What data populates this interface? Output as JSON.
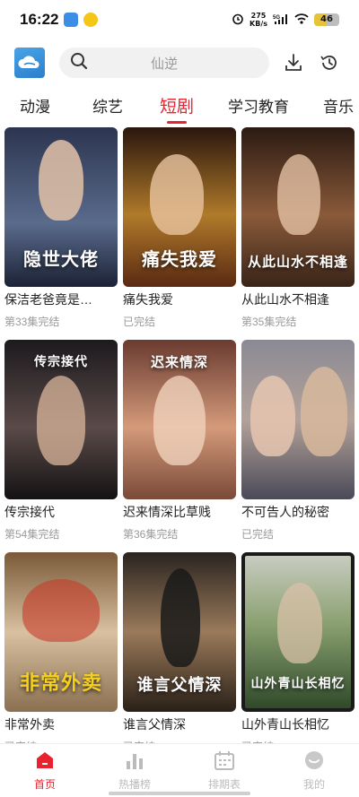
{
  "status": {
    "time": "16:22",
    "speed_top": "275",
    "speed_bottom": "KB/s",
    "network": "5G",
    "battery": "46"
  },
  "search": {
    "placeholder": "仙逆"
  },
  "tabs": [
    {
      "label": "动漫"
    },
    {
      "label": "综艺"
    },
    {
      "label": "短剧"
    },
    {
      "label": "学习教育"
    },
    {
      "label": "音乐"
    }
  ],
  "active_tab": "短剧",
  "cards": [
    {
      "title": "保洁老爸竟是…",
      "status": "第33集完结",
      "poster_text": "隐世大佬",
      "colors": [
        "#2c3550",
        "#5a6b8c"
      ]
    },
    {
      "title": "痛失我爱",
      "status": "已完结",
      "poster_text": "痛失我爱",
      "colors": [
        "#3a1d12",
        "#b07a2a"
      ]
    },
    {
      "title": "从此山水不相逢",
      "status": "第35集完结",
      "poster_text": "从此山水不相逢",
      "colors": [
        "#2b1a12",
        "#8a5a3a"
      ]
    },
    {
      "title": "传宗接代",
      "status": "第54集完结",
      "poster_text": "传宗接代",
      "colors": [
        "#1d1a1e",
        "#5a4a48"
      ]
    },
    {
      "title": "迟来情深比草贱",
      "status": "第36集完结",
      "poster_text": "迟来情深",
      "colors": [
        "#6a3b30",
        "#d49a7a"
      ]
    },
    {
      "title": "不可告人的秘密",
      "status": "已完结",
      "poster_text": "",
      "colors": [
        "#5a5a6a",
        "#b4a29a"
      ]
    },
    {
      "title": "非常外卖",
      "status": "已完结",
      "poster_text": "非常外卖",
      "colors": [
        "#7a5a38",
        "#d8c0a0"
      ]
    },
    {
      "title": "谁言父情深",
      "status": "已完结",
      "poster_text": "谁言父情深",
      "colors": [
        "#2a2420",
        "#9a7a5a"
      ]
    },
    {
      "title": "山外青山长相忆",
      "status": "已完结",
      "poster_text": "山外青山长相忆",
      "colors": [
        "#304a2a",
        "#8aa070"
      ]
    }
  ],
  "nav": [
    {
      "label": "首页",
      "icon": "home-icon"
    },
    {
      "label": "热播榜",
      "icon": "chart-icon"
    },
    {
      "label": "排期表",
      "icon": "calendar-icon"
    },
    {
      "label": "我的",
      "icon": "profile-icon"
    }
  ],
  "colors": {
    "accent": "#e8232f",
    "brand": "#2b7fcc"
  }
}
